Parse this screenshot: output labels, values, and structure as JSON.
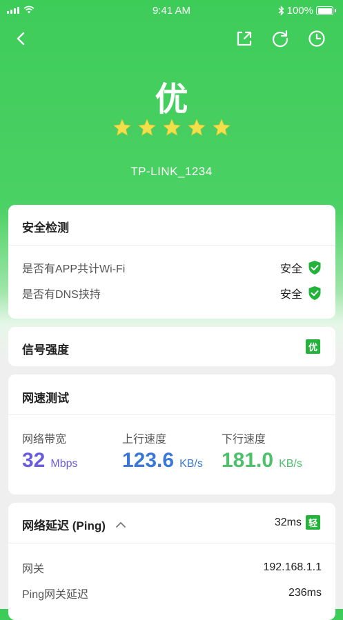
{
  "status_bar": {
    "time": "9:41 AM",
    "battery": "100%"
  },
  "header": {
    "grade": "优",
    "rating_stars": 5,
    "ssid": "TP-LINK_1234"
  },
  "security": {
    "title": "安全检测",
    "items": [
      {
        "label": "是否有APP共计Wi-Fi",
        "value": "安全"
      },
      {
        "label": "是否有DNS挟持",
        "value": "安全"
      }
    ]
  },
  "signal": {
    "title": "信号强度",
    "badge": "优"
  },
  "speed_test": {
    "title": "网速测试",
    "bandwidth": {
      "label": "网络带宽",
      "value": "32",
      "unit": "Mbps",
      "color": "#6a5ddb"
    },
    "upload": {
      "label": "上行速度",
      "value": "123.6",
      "unit": "KB/s",
      "color": "#3a78d8"
    },
    "download": {
      "label": "下行速度",
      "value": "181.0",
      "unit": "KB/s",
      "color": "#4cc06a"
    }
  },
  "latency": {
    "title": "网络延迟 (Ping)",
    "summary": "32ms",
    "badge": "轻",
    "rows": [
      {
        "label": "网关",
        "value": "192.168.1.1"
      },
      {
        "label": "Ping网关延迟",
        "value": "236ms"
      }
    ]
  },
  "colors": {
    "accent_green": "#23b33a",
    "header_green": "#3ecc59",
    "star": "#f2e04a"
  },
  "icons": [
    "back-icon",
    "share-icon",
    "refresh-icon",
    "history-icon",
    "shield-check-icon",
    "chevron-up-icon",
    "star-icon"
  ]
}
